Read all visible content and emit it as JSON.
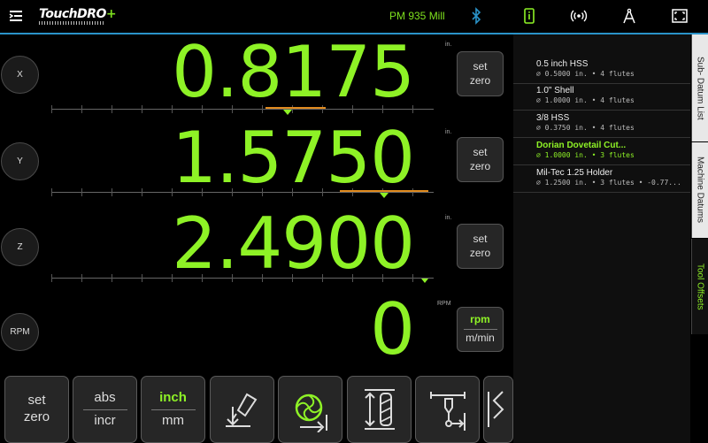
{
  "app": {
    "brand": "TouchDRO",
    "brand_plus": "+",
    "machine_name": "PM 935 Mill"
  },
  "top_icons": [
    "menu-icon",
    "bluetooth-icon",
    "info-icon",
    "wireless-icon",
    "compass-icon",
    "fullscreen-icon"
  ],
  "axes": [
    {
      "label": "X",
      "value": "0.8175",
      "unit": "in.",
      "zero_label_1": "set",
      "zero_label_2": "zero"
    },
    {
      "label": "Y",
      "value": "1.5750",
      "unit": "in.",
      "zero_label_1": "set",
      "zero_label_2": "zero"
    },
    {
      "label": "Z",
      "value": "2.4900",
      "unit": "in.",
      "zero_label_1": "set",
      "zero_label_2": "zero"
    },
    {
      "label": "RPM",
      "value": "0",
      "unit": "RPM",
      "zero_label_1": "rpm",
      "zero_label_2": "m/min"
    }
  ],
  "bottom_buttons": [
    {
      "top": "set",
      "bottom": "zero"
    },
    {
      "top": "abs",
      "bottom": "incr"
    },
    {
      "top": "inch",
      "bottom": "mm"
    }
  ],
  "bottom_icon_buttons": [
    "tool-offset-icon",
    "end-mill-icon",
    "tool-length-icon",
    "probe-icon",
    "edge-icon"
  ],
  "tool_list": [
    {
      "name": "0.5 inch HSS",
      "detail": "⌀ 0.5000 in. • 4 flutes",
      "active": false
    },
    {
      "name": "1.0\" Shell",
      "detail": "⌀ 1.0000 in. • 4 flutes",
      "active": false
    },
    {
      "name": "3/8 HSS",
      "detail": "⌀ 0.3750 in. • 4 flutes",
      "active": false
    },
    {
      "name": "Dorian Dovetail Cut...",
      "detail": "⌀ 1.0000 in. • 3 flutes",
      "active": true
    },
    {
      "name": "Mil-Tec 1.25 Holder",
      "detail": "⌀ 1.2500 in. • 3 flutes • -0.77...",
      "active": false
    }
  ],
  "side_tabs": [
    {
      "label": "Sub- Datum List",
      "active": false
    },
    {
      "label": "Machine Datums",
      "active": false
    },
    {
      "label": "Tool Offsets",
      "active": true
    }
  ],
  "colors": {
    "accent": "#8ef226",
    "divider": "#2a93c9",
    "marker": "#e08a1e"
  }
}
